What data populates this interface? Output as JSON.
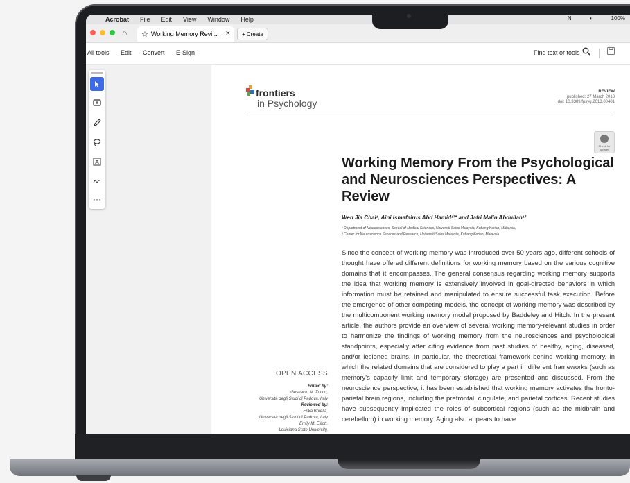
{
  "menubar": {
    "app": "Acrobat",
    "items": [
      "File",
      "Edit",
      "View",
      "Window",
      "Help"
    ],
    "right": [
      "N",
      "◐",
      "100%"
    ]
  },
  "tabbar": {
    "tab_title": "Working Memory Revi...",
    "create_label": "+ Create",
    "traffic_colors": [
      "#ff5f57",
      "#febc2e",
      "#28c840"
    ]
  },
  "toolbar": {
    "items": [
      "All tools",
      "Edit",
      "Convert",
      "E-Sign"
    ],
    "find_label": "Find text or tools"
  },
  "tools": {
    "icons": [
      "cursor-icon",
      "comment-icon",
      "pen-icon",
      "lasso-icon",
      "text-box-icon",
      "signature-icon",
      "more-icon"
    ],
    "active": 0
  },
  "document": {
    "journal_line1": "frontiers",
    "journal_line2": "in Psychology",
    "article_type": "REVIEW",
    "published": "published: 27 March 2018",
    "doi": "doi: 10.3389/fpsyg.2018.00401",
    "badge_text": "Check for updates",
    "title": "Working Memory From the Psychological and Neurosciences Perspectives: A Review",
    "authors": "Wen Jia Chai¹, Aini Ismafairus Abd Hamid¹²* and Jafri Malin Abdullah¹²",
    "affiliation1": "¹ Department of Neurosciences, School of Medical Sciences, Universiti Sains Malaysia, Kubang Kerian, Malaysia,",
    "affiliation2": "² Center for Neuroscience Services and Research, Universiti Sains Malaysia, Kubang Kerian, Malaysia",
    "abstract": "Since the concept of working memory was introduced over 50 years ago, different schools of thought have offered different definitions for working memory based on the various cognitive domains that it encompasses. The general consensus regarding working memory supports the idea that working memory is extensively involved in goal-directed behaviors in which information must be retained and manipulated to ensure successful task execution. Before the emergence of other competing models, the concept of working memory was described by the multicomponent working memory model proposed by Baddeley and Hitch. In the present article, the authors provide an overview of several working memory-relevant studies in order to harmonize the findings of working memory from the neurosciences and psychological standpoints, especially after citing evidence from past studies of healthy, aging, diseased, and/or lesioned brains. In particular, the theoretical framework behind working memory, in which the related domains that are considered to play a part in different frameworks (such as memory's capacity limit and temporary storage) are presented and discussed. From the neuroscience perspective, it has been established that working memory activates the fronto-parietal brain regions, including the prefrontal, cingulate, and parietal cortices. Recent studies have subsequently implicated the roles of subcortical regions (such as the midbrain and cerebellum) in working memory. Aging also appears to have",
    "open_access": "OPEN ACCESS",
    "edited_by_label": "Edited by:",
    "editor_name": "Gesualdo M. Zucco,",
    "editor_affil": "Università degli Studi di Padova, Italy",
    "reviewed_by_label": "Reviewed by:",
    "reviewer1_name": "Erika Borella,",
    "reviewer1_affil": "Università degli Studi di Padova, Italy",
    "reviewer2_name": "Emily M. Elliott,",
    "reviewer2_affil": "Louisiana State University,"
  }
}
